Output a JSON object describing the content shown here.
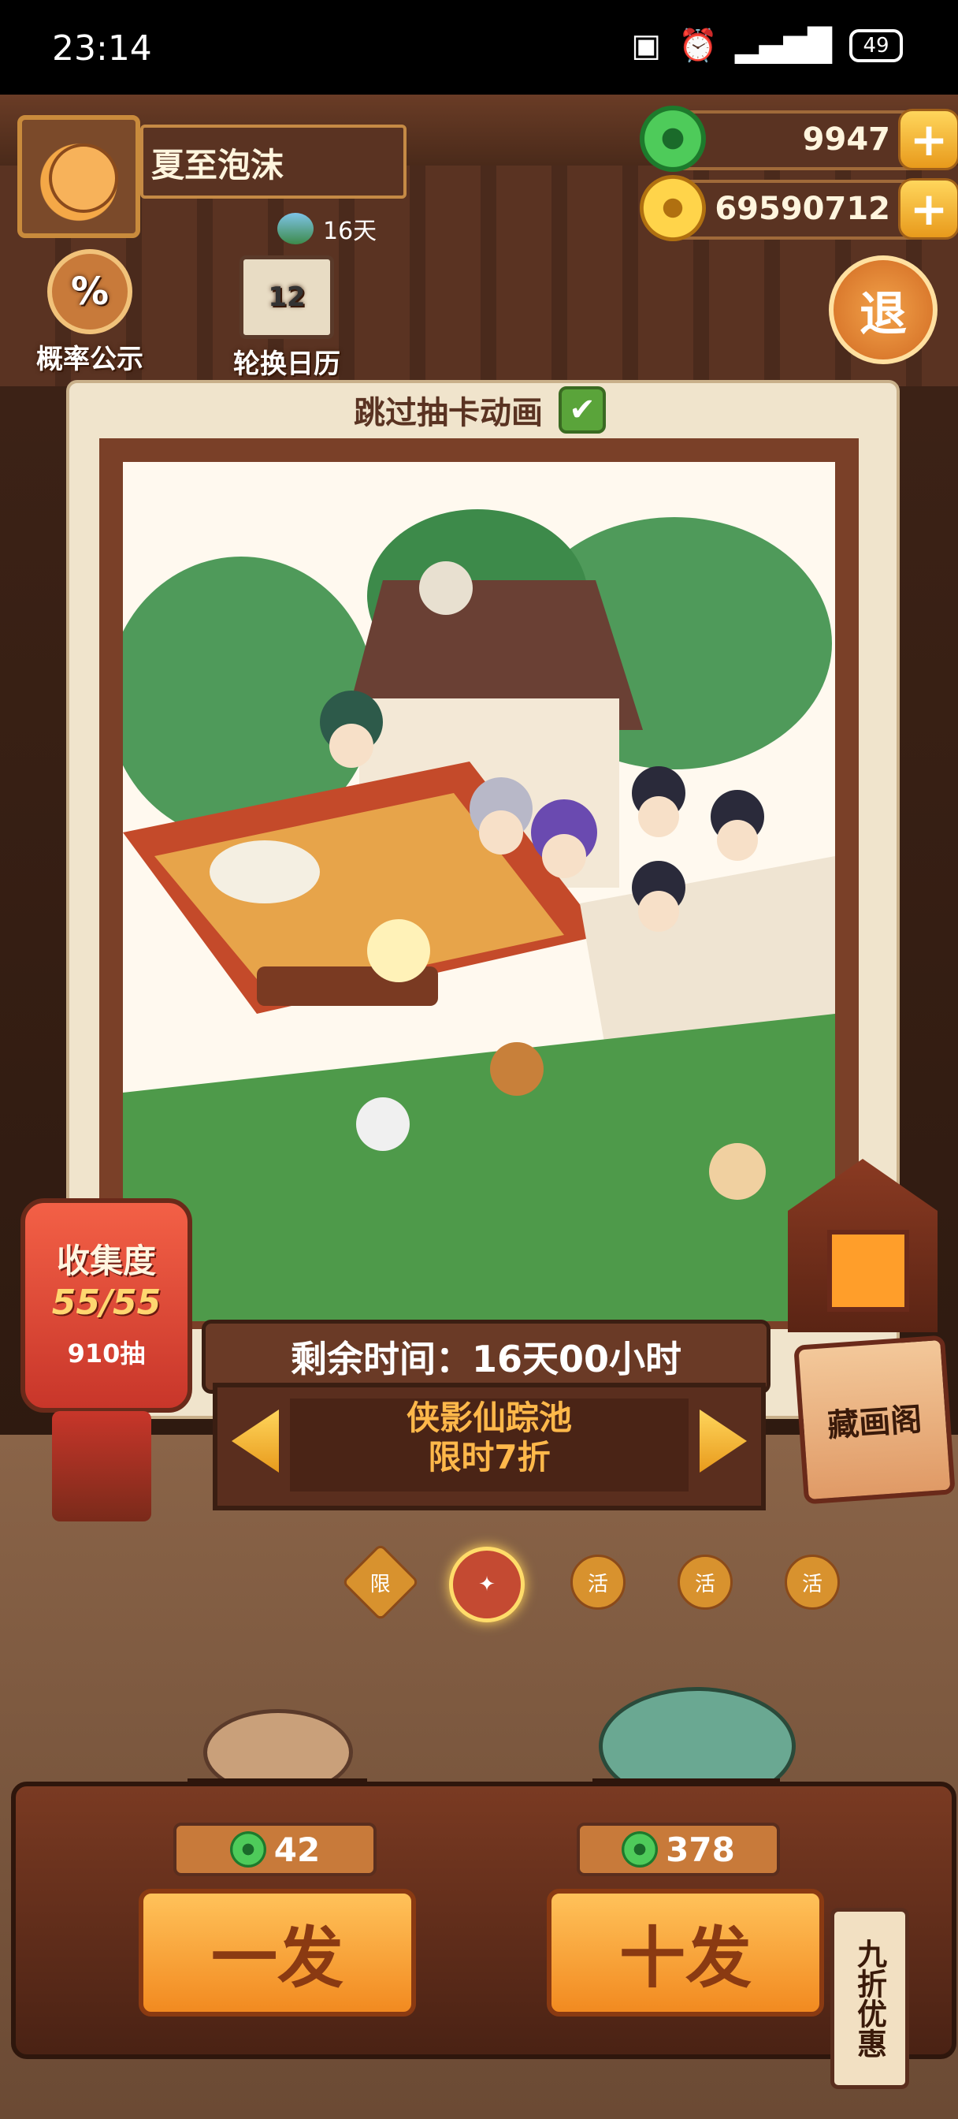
{
  "status_bar": {
    "time": "23:14",
    "battery": "49"
  },
  "player": {
    "name": "夏至泡沫",
    "days": "16天"
  },
  "currency": {
    "jade": "9947",
    "gold": "69590712",
    "plus": "+"
  },
  "top_icons": {
    "probability_label": "概率公示",
    "probability_glyph": "%",
    "calendar_label": "轮换日历",
    "calendar_glyph": "12",
    "exit_label": "退"
  },
  "skip_animation": {
    "label": "跳过抽卡动画",
    "checked": true,
    "mark": "✔"
  },
  "collection": {
    "title": "收集度",
    "progress": "55/55",
    "draws": "910抽"
  },
  "banner": {
    "remaining": "剩余时间：16天00小时",
    "pool_line1": "侠影仙踪池",
    "pool_line2": "限时7折"
  },
  "gallery_button": "藏画阁",
  "pool_dots": [
    {
      "label": "限",
      "active": false
    },
    {
      "label": "✦",
      "active": true
    },
    {
      "label": "活",
      "active": false
    },
    {
      "label": "活",
      "active": false
    },
    {
      "label": "活",
      "active": false
    }
  ],
  "draw": {
    "single": {
      "label": "一发",
      "price": "42"
    },
    "ten": {
      "label": "十发",
      "price": "378"
    },
    "discount_tag": "九折优惠"
  }
}
